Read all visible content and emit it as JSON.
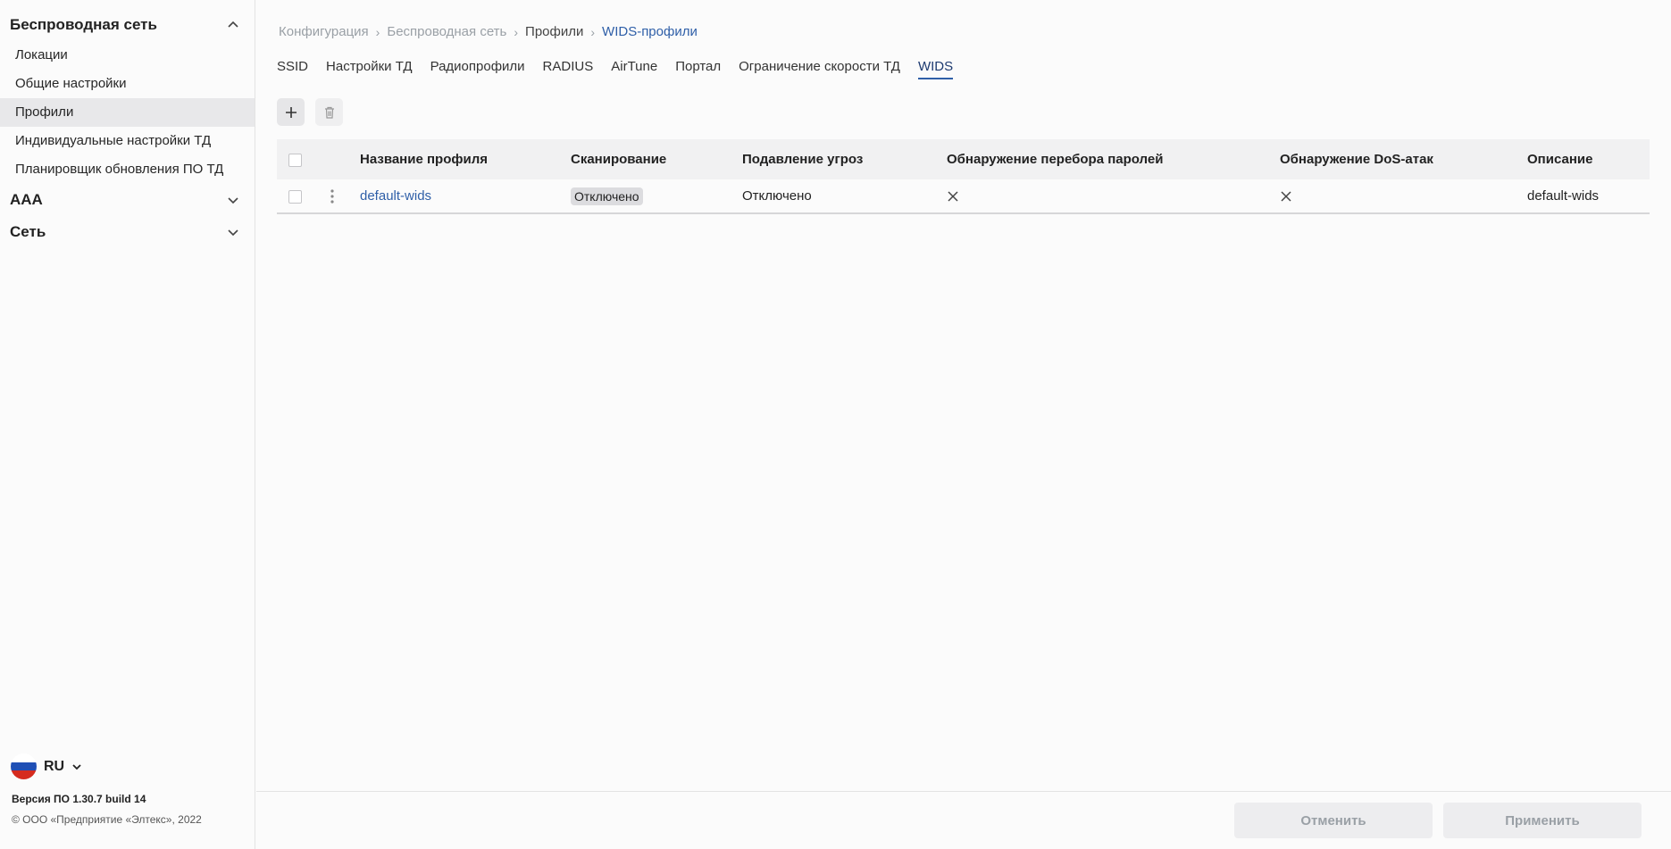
{
  "sidebar": {
    "groups": [
      {
        "label": "Беспроводная сеть",
        "expanded": true
      },
      {
        "label": "AAA",
        "expanded": false
      },
      {
        "label": "Сеть",
        "expanded": false
      }
    ],
    "items": [
      {
        "label": "Локации"
      },
      {
        "label": "Общие настройки"
      },
      {
        "label": "Профили",
        "active": true
      },
      {
        "label": "Индивидуальные настройки ТД"
      },
      {
        "label": "Планировщик обновления ПО ТД"
      }
    ],
    "language": "RU",
    "version": "Версия ПО 1.30.7 build 14",
    "copyright": "© ООО «Предприятие «Элтекс», 2022"
  },
  "breadcrumb": [
    "Конфигурация",
    "Беспроводная сеть",
    "Профили",
    "WIDS-профили"
  ],
  "tabs": [
    {
      "label": "SSID"
    },
    {
      "label": "Настройки ТД"
    },
    {
      "label": "Радиопрофили"
    },
    {
      "label": "RADIUS"
    },
    {
      "label": "AirTune"
    },
    {
      "label": "Портал"
    },
    {
      "label": "Ограничение скорости ТД"
    },
    {
      "label": "WIDS",
      "active": true
    }
  ],
  "table": {
    "columns": [
      "Название профиля",
      "Сканирование",
      "Подавление угроз",
      "Обнаружение перебора паролей",
      "Обнаружение DoS-атак",
      "Описание"
    ],
    "rows": [
      {
        "name": "default-wids",
        "scanning": "Отключено",
        "suppression": "Отключено",
        "bruteforce": "x-icon",
        "dos": "x-icon",
        "description": "default-wids"
      }
    ]
  },
  "footer": {
    "cancel_label": "Отменить",
    "apply_label": "Применить"
  },
  "colors": {
    "accent": "#2f5fa8",
    "active_bg": "#e8e8ea"
  }
}
